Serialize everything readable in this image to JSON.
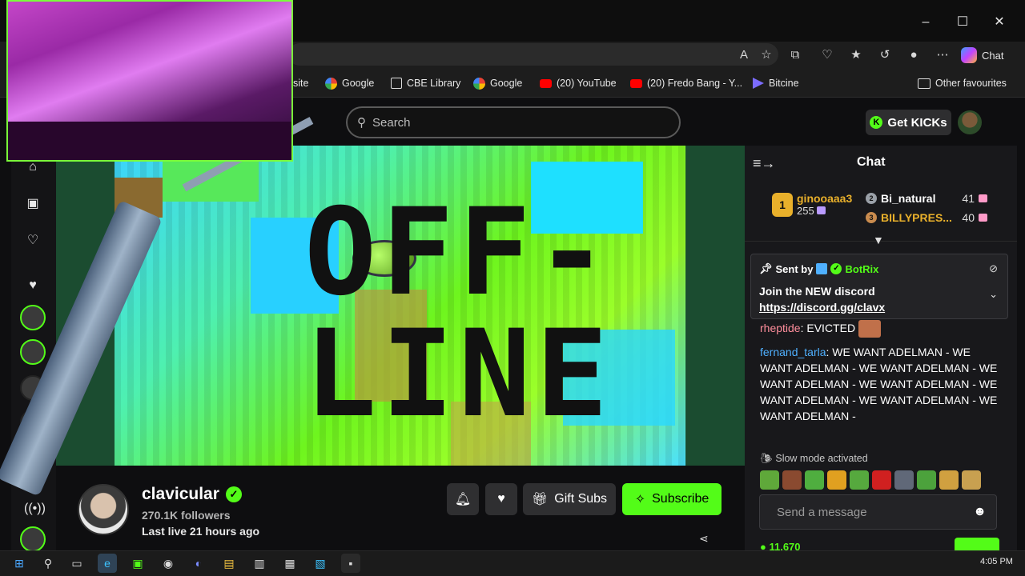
{
  "window": {
    "minimize": "–",
    "maximize": "☐",
    "close": "✕"
  },
  "toolbar": {
    "chat_label": "Chat"
  },
  "bookmarks": {
    "partial": "site",
    "items": [
      "Google",
      "CBE Library",
      "Google",
      "(20) YouTube",
      "(20) Fredo Bang - Y...",
      "Bitcine"
    ],
    "other": "Other favourites"
  },
  "header": {
    "search_placeholder": "Search",
    "get_kicks": "Get KICKs"
  },
  "player": {
    "offline_line1": "OFF-",
    "offline_line2": "LINE"
  },
  "channel": {
    "name": "clavicular",
    "followers": "270.1K followers",
    "last_live": "Last live 21 hours ago",
    "gift_subs": "Gift Subs",
    "subscribe": "Subscribe"
  },
  "chat": {
    "title": "Chat",
    "leaderboard": {
      "first": {
        "rank": "1",
        "name": "ginooaaa3",
        "count": "255"
      },
      "second": {
        "rank": "2",
        "name": "Bi_natural",
        "count": "41"
      },
      "third": {
        "rank": "3",
        "name": "BILLYPRES...",
        "count": "40"
      }
    },
    "pinned": {
      "sent_by": "Sent by",
      "bot": "BotRix",
      "line1": "Join the NEW discord",
      "link": "https://discord.gg/clavx"
    },
    "messages": [
      {
        "user": "rheptide",
        "text": "EVICTED"
      },
      {
        "user": "fernand_tarla",
        "text": "WE WANT ADELMAN - WE WANT ADELMAN - WE WANT ADELMAN - WE WANT ADELMAN - WE WANT ADELMAN - WE WANT ADELMAN - WE WANT ADELMAN - WE WANT ADELMAN -"
      }
    ],
    "slow_mode": "Slow mode activated",
    "send_placeholder": "Send a message",
    "viewer_count": "11,670"
  },
  "taskbar": {
    "time": "4:05 PM"
  },
  "colors": {
    "kick_green": "#53fc18",
    "chat_bg": "#18181b",
    "user1": "#ff8e9c",
    "user2": "#4fb0ff"
  }
}
